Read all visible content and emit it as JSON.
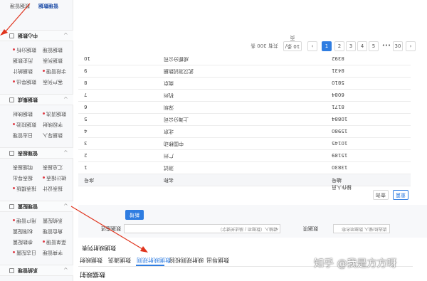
{
  "colors": {
    "accent": "#2f7de1",
    "arrow": "#e0341d",
    "dot": "#e0404a"
  },
  "sidebar": {
    "top_items": [
      "管理数据",
      "数据管理"
    ],
    "groups": [
      {
        "title": "中心数据",
        "items": [
          "数据管理",
          "数据分析",
          "数据列表",
          "历史数据",
          "字段管理",
          "数据统计",
          "客户列表",
          "数据导出"
        ]
      },
      {
        "title": "数据集成",
        "items": [
          "数据清洗",
          "数据映射",
          "字段映射",
          "数据校验",
          "数据导入",
          "日志管理"
        ]
      },
      {
        "title": "管理报表",
        "items": [
          "汇总报表",
          "明细报表",
          "统计报表",
          "报表导出",
          "报表设计",
          "报表模板"
        ]
      },
      {
        "title": "管理配置",
        "items": [
          "系统配置",
          "用户管理",
          "角色管理",
          "权限配置",
          "菜单管理",
          "参数配置",
          "字典管理",
          "日志配置"
        ]
      },
      {
        "title": "系统管理",
        "items": []
      }
    ]
  },
  "pagination": {
    "total_text": "共有 300 条",
    "page_size": "10 条/页",
    "pages": [
      "1",
      "2",
      "3",
      "4",
      "5",
      "•••",
      "30"
    ],
    "active_page": "1",
    "prev": "‹",
    "next": "›"
  },
  "table": {
    "header": [
      "序号",
      "名称",
      "编号"
    ],
    "rows": [
      [
        "1",
        "测试",
        "13830"
      ],
      [
        "2",
        "广州",
        "15189"
      ],
      [
        "3",
        "中国移动",
        "10145"
      ],
      [
        "4",
        "北京",
        "15980"
      ],
      [
        "5",
        "上海分公司",
        "10884"
      ],
      [
        "6",
        "深圳",
        "8171"
      ],
      [
        "7",
        "杭州",
        "6084"
      ],
      [
        "8",
        "南京",
        "5810"
      ],
      [
        "9",
        "武汉测试数据",
        "8431"
      ],
      [
        "10",
        "成都分公司",
        "8392"
      ]
    ],
    "extra_header": "操作人员"
  },
  "actions": {
    "query": "查询",
    "reset": "重置"
  },
  "filter": {
    "label_a": "数据项",
    "input_a": "请选择/输入 数据项名称",
    "label_b": "数据描述",
    "input_b": "请输入（数据项 / 描述关键字）",
    "add_button": "新增"
  },
  "section_title": "数据映射列表",
  "tabs": [
    "数据映射",
    "数据清洗",
    "数据映射规则",
    "映射规则校验",
    "数据导出"
  ],
  "active_tab": "数据映射规则",
  "page_title": "数据映射",
  "watermark": "知乎 @我是方方呀"
}
